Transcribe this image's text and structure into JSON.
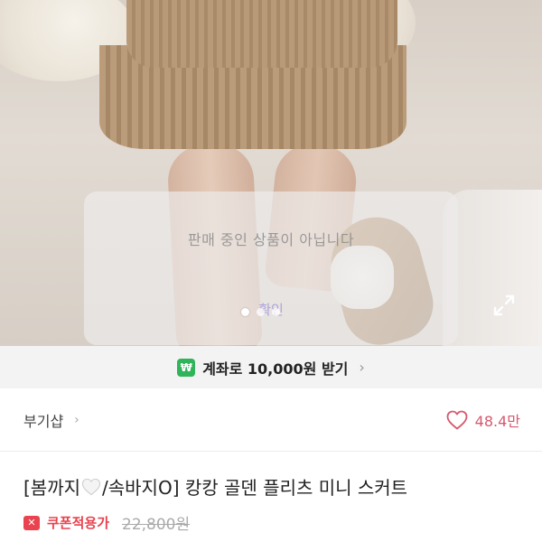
{
  "notice": {
    "message": "판매 중인 상품이 아닙니다",
    "confirm_label": "확인"
  },
  "gallery": {
    "dots": 3,
    "active_dot": 1
  },
  "promo": {
    "icon_glyph": "₩",
    "text": "계좌로 10,000원 받기",
    "chevron": "›",
    "icon_color": "#2fb45a"
  },
  "shop": {
    "name": "부기샵",
    "chevron": "›",
    "likes": "48.4만",
    "like_color": "#d65a6e"
  },
  "product": {
    "title_prefix": "[봄까지",
    "title_suffix": "/속바지O] 캉캉 골덴 플리츠 미니 스커트",
    "coupon_icon": "✕",
    "coupon_label": "쿠폰적용가",
    "original_price": "22,800원",
    "coupon_color": "#e8434f"
  },
  "icons": {
    "expand": "expand-icon",
    "heart": "heart-outline-icon",
    "white_heart": "white-heart-emoji"
  }
}
